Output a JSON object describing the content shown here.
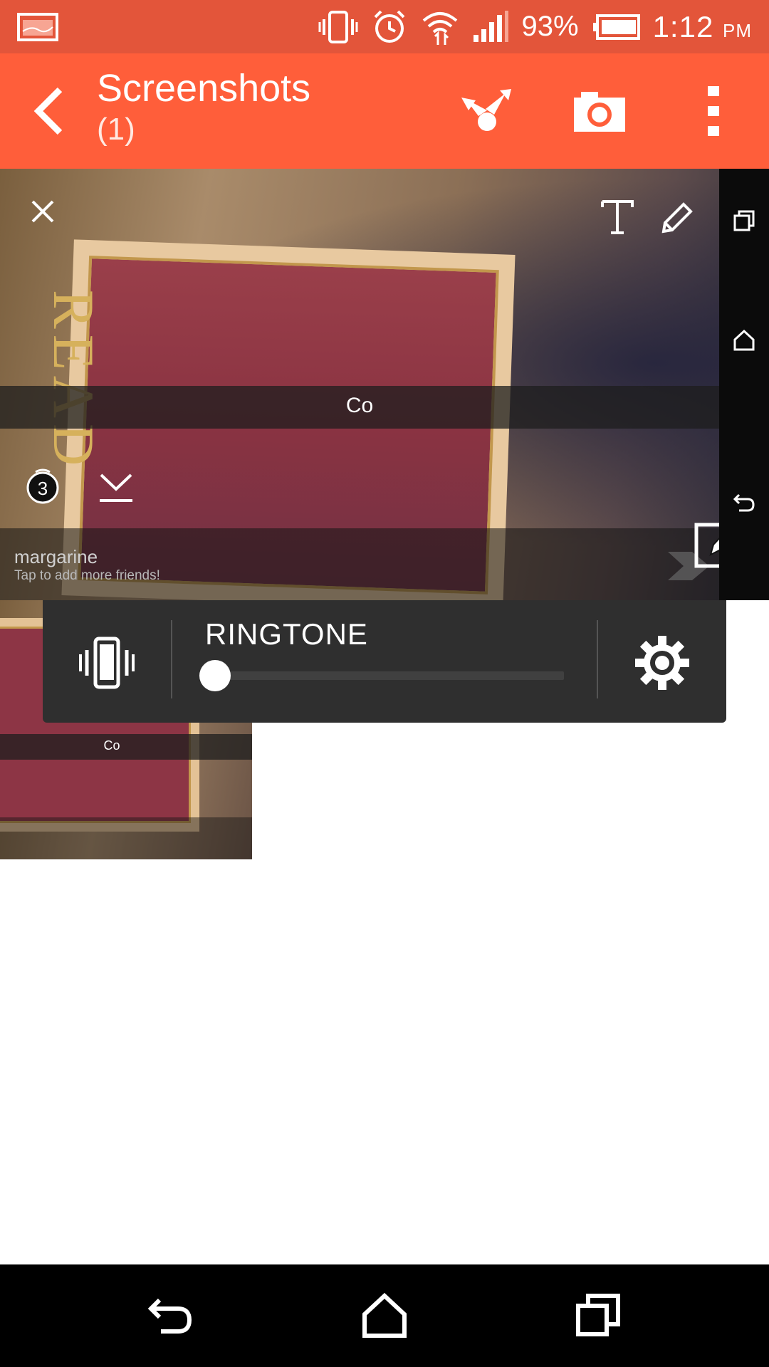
{
  "status_bar": {
    "battery": "93%",
    "time": "1:12",
    "ampm": "PM",
    "icons": [
      "notification-image-icon",
      "vibrate-icon",
      "alarm-icon",
      "wifi-icon",
      "signal-icon",
      "battery-icon"
    ]
  },
  "action_bar": {
    "title": "Screenshots",
    "subtitle": "(1)",
    "icons": [
      "back-icon",
      "share-icon",
      "camera-icon",
      "overflow-menu-icon"
    ],
    "background": "#ff5e3a",
    "status_background": "#e3553a"
  },
  "photo": {
    "poster_word": "READ",
    "caption": "Co",
    "timer": "3",
    "friend_name": "margarine",
    "friend_hint": "Tap to add more friends!",
    "icons": [
      "close-icon",
      "text-tool-icon",
      "pencil-icon",
      "timer-icon",
      "download-icon",
      "send-arrow-icon",
      "edit-icon",
      "recents-icon",
      "home-icon",
      "back-icon"
    ]
  },
  "volume_popup": {
    "label": "RINGTONE",
    "level": 0.0,
    "icons": [
      "vibrate-mode-icon",
      "settings-gear-icon"
    ]
  },
  "thumbnail": {
    "caption": "Co"
  },
  "nav_bar": {
    "icons": [
      "back-icon",
      "home-icon",
      "recent-apps-icon"
    ]
  }
}
